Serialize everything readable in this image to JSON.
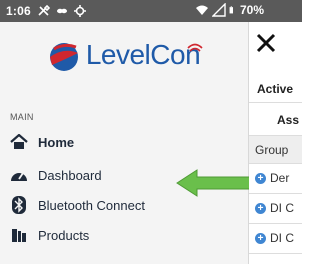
{
  "status_bar": {
    "time": "1:06",
    "notification_icons": [
      "tools-icon",
      "link-icon",
      "gear-icon"
    ],
    "wifi_icon": "wifi-icon",
    "signal_icon": "signal-icon",
    "battery_icon": "battery-icon",
    "battery": "70%"
  },
  "drawer": {
    "logo_text": "LevelCon",
    "section_label": "MAIN",
    "items": [
      {
        "label": "Home",
        "icon": "home-icon",
        "active": true
      },
      {
        "label": "Dashboard",
        "icon": "speedometer-icon"
      },
      {
        "label": "Bluetooth Connect",
        "icon": "bluetooth-icon"
      },
      {
        "label": "Products",
        "icon": "products-icon"
      }
    ]
  },
  "background_app": {
    "close_icon": "close-icon",
    "title": "Active",
    "column_header": "Ass",
    "group_label": "Group",
    "rows": [
      {
        "text": "Der"
      },
      {
        "text": "DI C"
      },
      {
        "text": "DI C"
      }
    ]
  },
  "colors": {
    "status_bar": "#5a5a5a",
    "drawer_bg": "#f4f4f4",
    "brand_blue": "#1f5aa8",
    "brand_red": "#d0272f",
    "arrow_green": "#6abf4b",
    "row_plus_blue": "#3f86d2"
  }
}
